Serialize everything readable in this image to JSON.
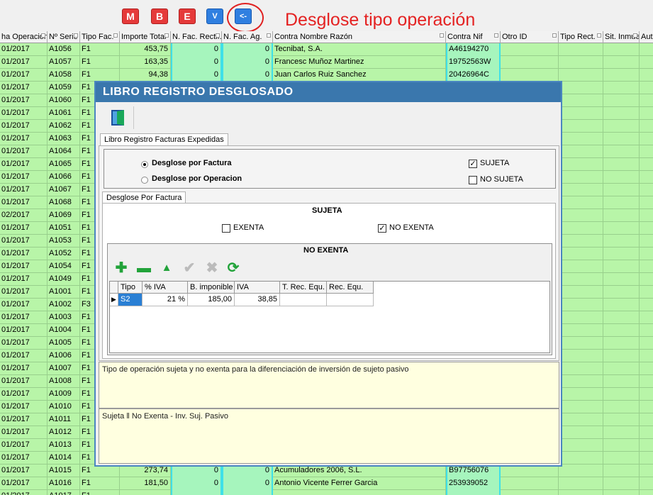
{
  "toolbar": {
    "buttons": [
      {
        "label": "M",
        "color": "#e53a3a"
      },
      {
        "label": "B",
        "color": "#e53a3a"
      },
      {
        "label": "E",
        "color": "#e53a3a"
      },
      {
        "label": "V",
        "color": "#2f7fe0"
      },
      {
        "label": "<-",
        "color": "#2f7fe0"
      }
    ]
  },
  "annotation": {
    "text": "Desglose tipo operación",
    "color": "#e42222"
  },
  "grid": {
    "columns": [
      "ha Operación",
      "Nº Serie",
      "Tipo Fac.",
      "Importe Total",
      "N. Fac. Rectif.",
      "N. Fac. Ag.",
      "Contra Nombre Razón",
      "Contra Nif",
      "Otro ID",
      "Tipo Rect.",
      "Sit. Inmue",
      "Aut"
    ],
    "rows": [
      [
        "01/2017",
        "A1056",
        "F1",
        "453,75",
        "0",
        "0",
        "Tecnibat, S.A.",
        "A46194270"
      ],
      [
        "01/2017",
        "A1057",
        "F1",
        "163,35",
        "0",
        "0",
        "Francesc Muñoz Martinez",
        "19752563W"
      ],
      [
        "01/2017",
        "A1058",
        "F1",
        "94,38",
        "0",
        "0",
        "Juan Carlos Ruiz Sanchez",
        "20426964C"
      ],
      [
        "01/2017",
        "A1059",
        "F1",
        "",
        "",
        "",
        "",
        ""
      ],
      [
        "01/2017",
        "A1060",
        "F1",
        "",
        "",
        "",
        "",
        ""
      ],
      [
        "01/2017",
        "A1061",
        "F1",
        "",
        "",
        "",
        "",
        ""
      ],
      [
        "01/2017",
        "A1062",
        "F1",
        "",
        "",
        "",
        "",
        ""
      ],
      [
        "01/2017",
        "A1063",
        "F1",
        "",
        "",
        "",
        "",
        ""
      ],
      [
        "01/2017",
        "A1064",
        "F1",
        "",
        "",
        "",
        "",
        ""
      ],
      [
        "01/2017",
        "A1065",
        "F1",
        "",
        "",
        "",
        "",
        ""
      ],
      [
        "01/2017",
        "A1066",
        "F1",
        "",
        "",
        "",
        "",
        ""
      ],
      [
        "01/2017",
        "A1067",
        "F1",
        "",
        "",
        "",
        "",
        ""
      ],
      [
        "01/2017",
        "A1068",
        "F1",
        "",
        "",
        "",
        "",
        ""
      ],
      [
        "02/2017",
        "A1069",
        "F1",
        "",
        "",
        "",
        "",
        ""
      ],
      [
        "01/2017",
        "A1051",
        "F1",
        "",
        "",
        "",
        "",
        ""
      ],
      [
        "01/2017",
        "A1053",
        "F1",
        "",
        "",
        "",
        "",
        ""
      ],
      [
        "01/2017",
        "A1052",
        "F1",
        "",
        "",
        "",
        "",
        ""
      ],
      [
        "01/2017",
        "A1054",
        "F1",
        "",
        "",
        "",
        "",
        ""
      ],
      [
        "01/2017",
        "A1049",
        "F1",
        "",
        "",
        "",
        "",
        ""
      ],
      [
        "01/2017",
        "A1001",
        "F1",
        "",
        "",
        "",
        "",
        ""
      ],
      [
        "01/2017",
        "A1002",
        "F3",
        "",
        "",
        "",
        "",
        ""
      ],
      [
        "01/2017",
        "A1003",
        "F1",
        "",
        "",
        "",
        "",
        ""
      ],
      [
        "01/2017",
        "A1004",
        "F1",
        "",
        "",
        "",
        "",
        ""
      ],
      [
        "01/2017",
        "A1005",
        "F1",
        "",
        "",
        "",
        "",
        ""
      ],
      [
        "01/2017",
        "A1006",
        "F1",
        "",
        "",
        "",
        "",
        ""
      ],
      [
        "01/2017",
        "A1007",
        "F1",
        "",
        "",
        "",
        "",
        ""
      ],
      [
        "01/2017",
        "A1008",
        "F1",
        "",
        "",
        "",
        "",
        ""
      ],
      [
        "01/2017",
        "A1009",
        "F1",
        "",
        "",
        "",
        "",
        ""
      ],
      [
        "01/2017",
        "A1010",
        "F1",
        "",
        "",
        "",
        "",
        ""
      ],
      [
        "01/2017",
        "A1011",
        "F1",
        "",
        "",
        "",
        "",
        ""
      ],
      [
        "01/2017",
        "A1012",
        "F1",
        "",
        "",
        "",
        "",
        ""
      ],
      [
        "01/2017",
        "A1013",
        "F1",
        "",
        "",
        "",
        "",
        ""
      ],
      [
        "01/2017",
        "A1014",
        "F1",
        "",
        "",
        "",
        "",
        ""
      ],
      [
        "01/2017",
        "A1015",
        "F1",
        "273,74",
        "0",
        "0",
        "Acumuladores 2006, S.L.",
        "B97756076"
      ],
      [
        "01/2017",
        "A1016",
        "F1",
        "181,50",
        "0",
        "0",
        "Antonio Vicente Ferrer Garcia",
        "253939052"
      ],
      [
        "01/2017",
        "A1017",
        "F1",
        "",
        "",
        "",
        "",
        ""
      ]
    ]
  },
  "dialog": {
    "title": "LIBRO REGISTRO DESGLOSADO",
    "tab": "Libro Registro Facturas Expedidas",
    "options": {
      "desglose_factura": "Desglose por Factura",
      "desglose_operacion": "Desglose por Operacion",
      "sujeta": "SUJETA",
      "no_sujeta": "NO SUJETA"
    },
    "subtab": "Desglose Por Factura",
    "sujeta_header": "SUJETA",
    "exenta": "EXENTA",
    "no_exenta_cb": "NO EXENTA",
    "no_exenta_header": "NO EXENTA",
    "inner_grid": {
      "columns": [
        "Tipo",
        "% IVA",
        "B. imponible",
        "IVA",
        "T. Rec. Equ.",
        "Rec. Equ."
      ],
      "rows": [
        [
          "S2",
          "21 %",
          "185,00",
          "38,85",
          "",
          ""
        ]
      ]
    },
    "description": "Tipo de operación sujeta y no exenta para la diferenciación de inversión de sujeto pasivo",
    "path": "Sujeta ‖ No Exenta - Inv. Suj. Pasivo"
  }
}
